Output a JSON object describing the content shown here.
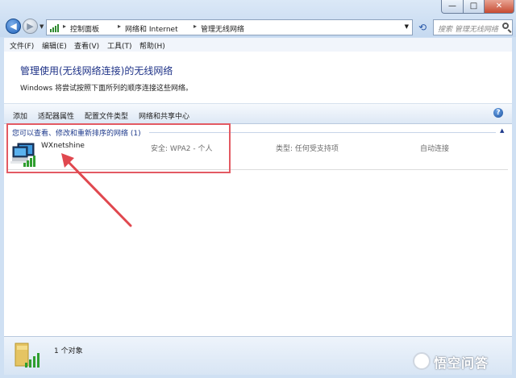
{
  "window": {
    "minimize_symbol": "—",
    "maximize_symbol": "□",
    "close_symbol": "✕"
  },
  "address_bar": {
    "breadcrumbs": [
      "控制面板",
      "网络和 Internet",
      "管理无线网络"
    ]
  },
  "search": {
    "placeholder": "搜索 管理无线网络"
  },
  "menu": {
    "items": [
      "文件(F)",
      "编辑(E)",
      "查看(V)",
      "工具(T)",
      "帮助(H)"
    ]
  },
  "main": {
    "heading": "管理使用(无线网络连接)的无线网络",
    "subtitle": "Windows 将尝试按照下面所列的顺序连接这些网络。"
  },
  "toolbar": {
    "items": [
      "添加",
      "适配器属性",
      "配置文件类型",
      "网络和共享中心"
    ]
  },
  "network_group": {
    "label": "您可以查看、修改和重新排序的网络 (1)",
    "networks": [
      {
        "name": "WXnetshine",
        "security": "安全: WPA2 - 个人",
        "type": "类型: 任何受支持项",
        "connection": "自动连接"
      }
    ]
  },
  "status": {
    "count": "1 个对象"
  },
  "watermark": {
    "text": "悟空问答"
  },
  "colors": {
    "heading": "#1e3287",
    "highlight_box": "#e35a63",
    "window_frame": "#cfe0f3"
  }
}
